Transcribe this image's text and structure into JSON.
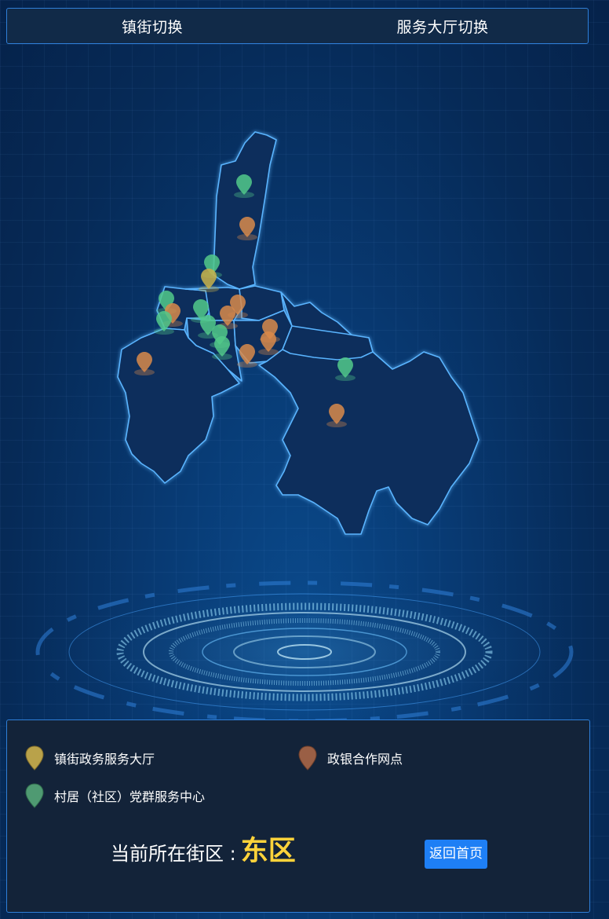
{
  "header": {
    "tabs": [
      {
        "label": "镇街切换"
      },
      {
        "label": "服务大厅切换"
      }
    ]
  },
  "map": {
    "marker_colors": {
      "hall": "#c9b14a",
      "bank": "#d9894a",
      "center": "#52c98a"
    }
  },
  "legend": {
    "items": [
      {
        "label": "镇街政务服务大厅",
        "icon": "yellow-map-pin-icon",
        "color": "#b9a24a"
      },
      {
        "label": "政银合作网点",
        "icon": "brown-map-pin-icon",
        "color": "#9a5f45"
      },
      {
        "label": "村居（社区）党群服务中心",
        "icon": "green-map-pin-icon",
        "color": "#4f9a72"
      }
    ]
  },
  "status": {
    "current_label": "当前所在街区 :",
    "current_value": "东区",
    "back_button": "返回首页"
  }
}
